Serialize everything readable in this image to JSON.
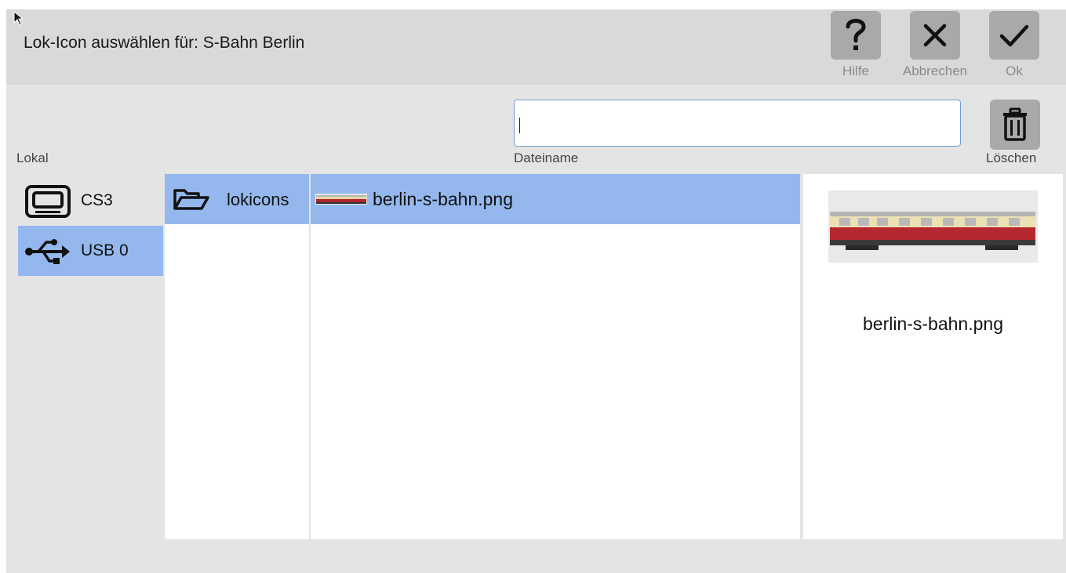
{
  "dialog": {
    "title": "Lok-Icon auswählen für: S-Bahn Berlin"
  },
  "toolbar": {
    "help_label": "Hilfe",
    "cancel_label": "Abbrechen",
    "ok_label": "Ok"
  },
  "source": {
    "heading": "Lokal",
    "devices": [
      {
        "label": "CS3",
        "icon": "cs3-device-icon",
        "selected": false
      },
      {
        "label": "USB 0",
        "icon": "usb-icon",
        "selected": true
      }
    ]
  },
  "filename": {
    "value": "",
    "label": "Dateiname"
  },
  "delete": {
    "label": "Löschen"
  },
  "folders": [
    {
      "label": "lokicons",
      "icon": "folder-open-icon",
      "selected": true
    }
  ],
  "files": [
    {
      "label": "berlin-s-bahn.png",
      "icon": "train-thumbnail",
      "selected": true
    }
  ],
  "preview": {
    "filename": "berlin-s-bahn.png"
  },
  "colors": {
    "selection": "#94b8ee",
    "button": "#a9a9a9",
    "input_border": "#6f9bcf"
  }
}
